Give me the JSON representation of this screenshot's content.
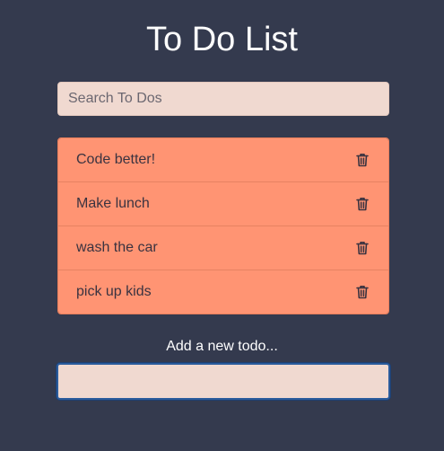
{
  "header": {
    "title": "To Do List"
  },
  "search": {
    "placeholder": "Search To Dos",
    "value": ""
  },
  "todos": [
    {
      "text": "Code better!",
      "icon": "trash-icon"
    },
    {
      "text": "Make lunch",
      "icon": "trash-icon"
    },
    {
      "text": "wash the car",
      "icon": "trash-icon"
    },
    {
      "text": "pick up kids",
      "icon": "trash-icon"
    }
  ],
  "add_form": {
    "label": "Add a new todo...",
    "value": ""
  },
  "colors": {
    "background": "#343a4e",
    "item_background": "#ff9473",
    "input_background": "#f0d9d0",
    "focus_border": "#2a5b9c"
  }
}
